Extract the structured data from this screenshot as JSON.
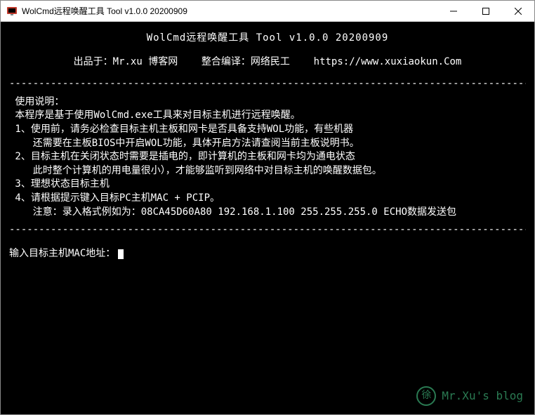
{
  "window": {
    "title": "WolCmd远程唤醒工具 Tool v1.0.0 20200909"
  },
  "console": {
    "header": "WolCmd远程唤醒工具 Tool v1.0.0 20200909",
    "credits": "出品于：Mr.xu 博客网    整合编译：网络民工    https://www.xuxiaokun.Com",
    "divider": "----------------------------------------------------------------------------------------------------",
    "instructions": " 使用说明：\n 本程序是基于使用WolCmd.exe工具来对目标主机进行远程唤醒。\n 1、使用前，请务必检查目标主机主板和网卡是否具备支持WOL功能，有些机器\n    还需要在主板BIOS中开启WOL功能，具体开启方法请查阅当前主板说明书。\n 2、目标主机在关闭状态时需要是插电的，即计算机的主板和网卡均为通电状态\n    此时整个计算机的用电量很小），才能够监听到网络中对目标主机的唤醒数据包。\n 3、理想状态目标主机\n 4、请根据提示键入目标PC主机MAC + PCIP。\n    注意：录入格式例如为：08CA45D60A80 192.168.1.100 255.255.255.0 ECHO数据发送包",
    "prompt": "输入目标主机MAC地址："
  },
  "watermark": {
    "icon": "徐",
    "text": "Mr.Xu's blog"
  }
}
